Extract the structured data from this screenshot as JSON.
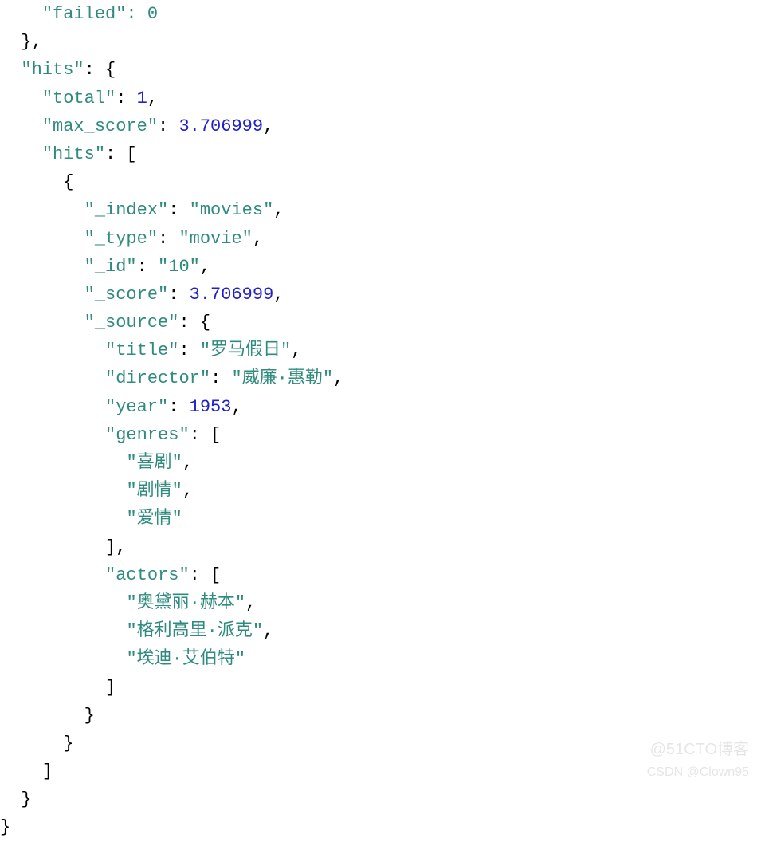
{
  "json": {
    "top_partial_line": "\"failed\": 0",
    "hits_key": "\"hits\"",
    "total_key": "\"total\"",
    "total_val": "1",
    "max_score_key": "\"max_score\"",
    "max_score_val": "3.706999",
    "hits_arr_key": "\"hits\"",
    "hit": {
      "index_key": "\"_index\"",
      "index_val": "\"movies\"",
      "type_key": "\"_type\"",
      "type_val": "\"movie\"",
      "id_key": "\"_id\"",
      "id_val": "\"10\"",
      "score_key": "\"_score\"",
      "score_val": "3.706999",
      "source_key": "\"_source\"",
      "title_key": "\"title\"",
      "title_val": "\"罗马假日\"",
      "director_key": "\"director\"",
      "director_val": "\"威廉·惠勒\"",
      "year_key": "\"year\"",
      "year_val": "1953",
      "genres_key": "\"genres\"",
      "genres": [
        "\"喜剧\"",
        "\"剧情\"",
        "\"爱情\""
      ],
      "actors_key": "\"actors\"",
      "actors": [
        "\"奥黛丽·赫本\"",
        "\"格利高里·派克\"",
        "\"埃迪·艾伯特\""
      ]
    }
  },
  "watermarks": {
    "w1": "@51CTO博客",
    "w2": "CSDN @Clown95"
  }
}
